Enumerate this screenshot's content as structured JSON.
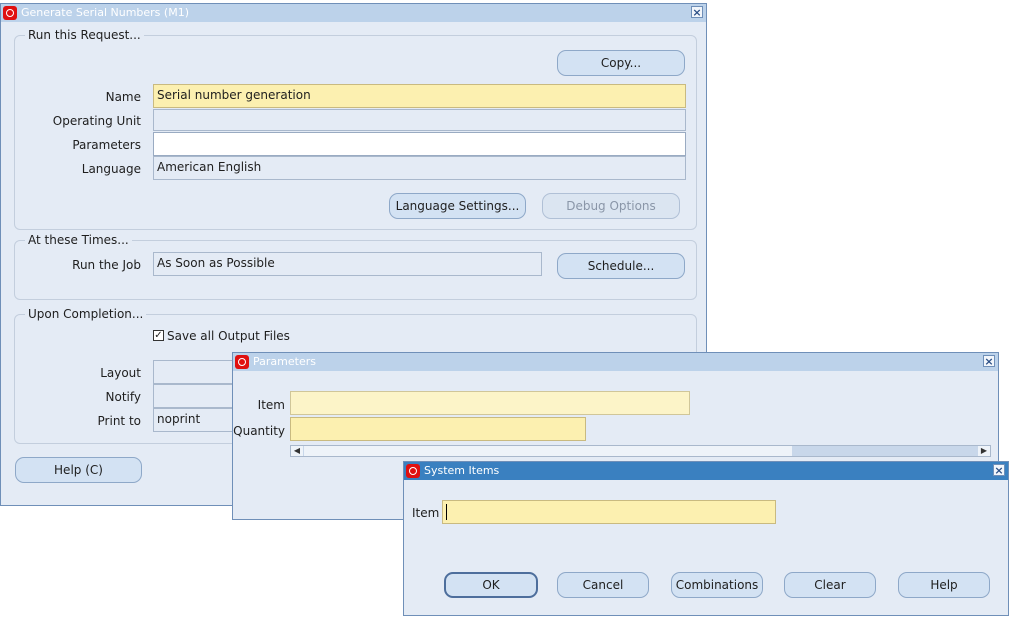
{
  "main_window": {
    "title": "Generate Serial Numbers (M1)",
    "run_request": {
      "group_label": "Run this Request...",
      "copy_button": "Copy...",
      "name_label": "Name",
      "name_value": "Serial number generation",
      "operating_unit_label": "Operating Unit",
      "operating_unit_value": "",
      "parameters_label": "Parameters",
      "parameters_value": "",
      "language_label": "Language",
      "language_value": "American English",
      "language_settings_button": "Language Settings...",
      "debug_options_button": "Debug Options"
    },
    "times": {
      "group_label": "At these Times...",
      "run_job_label": "Run the Job",
      "run_job_value": "As Soon as Possible",
      "schedule_button": "Schedule..."
    },
    "completion": {
      "group_label": "Upon Completion...",
      "save_output_label": "Save all Output Files",
      "save_output_checked": true,
      "layout_label": "Layout",
      "notify_label": "Notify",
      "print_to_label": "Print to",
      "print_to_value": "noprint"
    },
    "help_button": "Help (C)"
  },
  "parameters_window": {
    "title": "Parameters",
    "item_label": "Item",
    "item_value": "",
    "quantity_label": "Quantity",
    "quantity_value": ""
  },
  "system_items_window": {
    "title": "System Items",
    "item_label": "Item",
    "item_value": "",
    "ok_button": "OK",
    "cancel_button": "Cancel",
    "combinations_button": "Combinations",
    "clear_button": "Clear",
    "help_button": "Help"
  }
}
